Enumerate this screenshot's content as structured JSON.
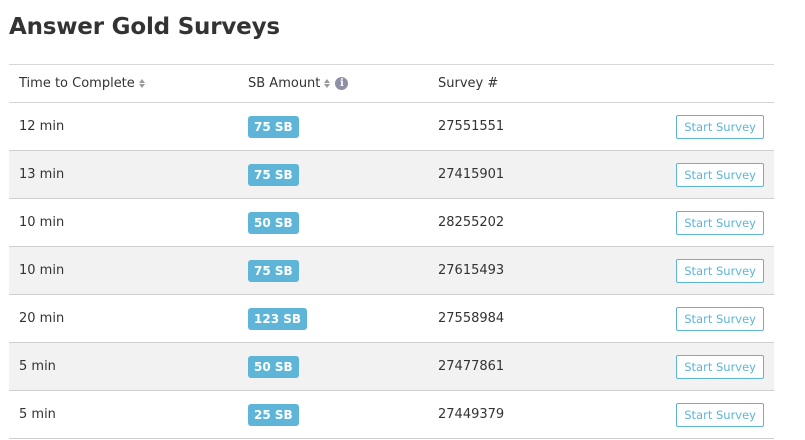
{
  "page": {
    "title": "Answer Gold Surveys"
  },
  "table": {
    "headers": {
      "time": "Time to Complete",
      "sb": "SB Amount",
      "survey": "Survey #"
    },
    "rows": [
      {
        "time": "12 min",
        "sb": "75 SB",
        "survey": "27551551",
        "action": "Start Survey"
      },
      {
        "time": "13 min",
        "sb": "75 SB",
        "survey": "27415901",
        "action": "Start Survey"
      },
      {
        "time": "10 min",
        "sb": "50 SB",
        "survey": "28255202",
        "action": "Start Survey"
      },
      {
        "time": "10 min",
        "sb": "75 SB",
        "survey": "27615493",
        "action": "Start Survey"
      },
      {
        "time": "20 min",
        "sb": "123 SB",
        "survey": "27558984",
        "action": "Start Survey"
      },
      {
        "time": "5 min",
        "sb": "50 SB",
        "survey": "27477861",
        "action": "Start Survey"
      },
      {
        "time": "5 min",
        "sb": "25 SB",
        "survey": "27449379",
        "action": "Start Survey"
      }
    ]
  },
  "icons": {
    "sort": "sort-icon",
    "info": "info-icon"
  },
  "colors": {
    "accent": "#5eb5d8",
    "row_alt": "#f2f2f2",
    "text": "#333333"
  }
}
